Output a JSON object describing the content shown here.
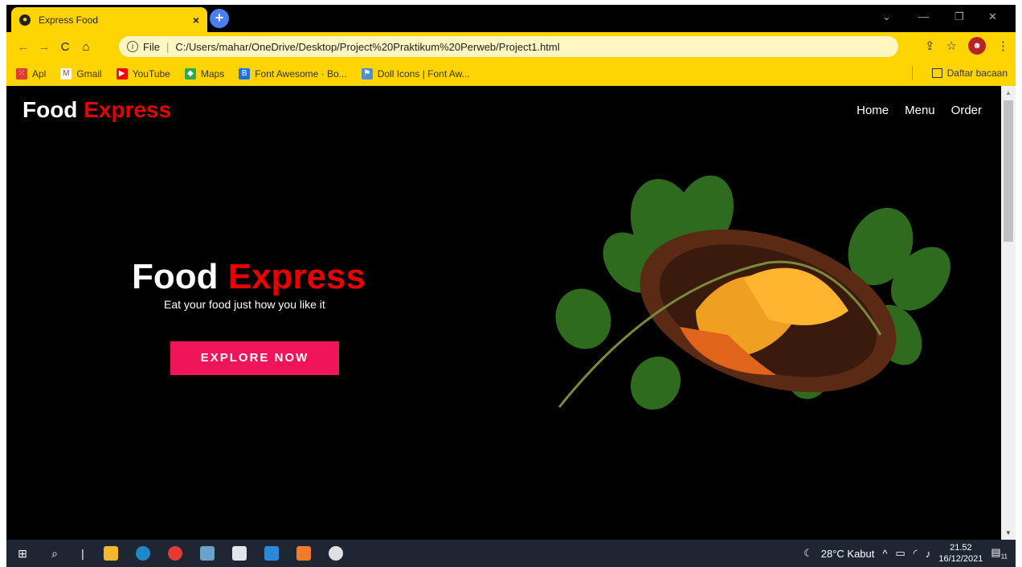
{
  "browser": {
    "tab_title": "Express Food",
    "tab_close": "×",
    "new_tab": "+",
    "address_scheme": "File",
    "address_url": "C:/Users/mahar/OneDrive/Desktop/Project%20Praktikum%20Perweb/Project1.html",
    "bookmarks": [
      {
        "label": "Apl",
        "color": "#e53935"
      },
      {
        "label": "Gmail",
        "color": "#d93025"
      },
      {
        "label": "YouTube",
        "color": "#ff0000"
      },
      {
        "label": "Maps",
        "color": "#34a853"
      },
      {
        "label": "Font Awesome · Bo...",
        "color": "#1a73e8"
      },
      {
        "label": "Doll Icons | Font Aw...",
        "color": "#4a90d9"
      }
    ],
    "reading_list": "Daftar bacaan"
  },
  "site": {
    "logo_white": "Food ",
    "logo_red": "Express",
    "nav": [
      "Home",
      "Menu",
      "Order"
    ],
    "hero_white": "Food ",
    "hero_red": "Express",
    "tagline": "Eat your food just how you like it",
    "cta": "EXPLORE NOW"
  },
  "colors": {
    "accent_red": "#e60000",
    "cta_pink": "#f0145a",
    "chrome_yellow": "#ffd400"
  },
  "taskbar": {
    "weather": "28°C  Kabut",
    "time": "21.52",
    "date": "16/12/2021",
    "notifications": "11"
  }
}
